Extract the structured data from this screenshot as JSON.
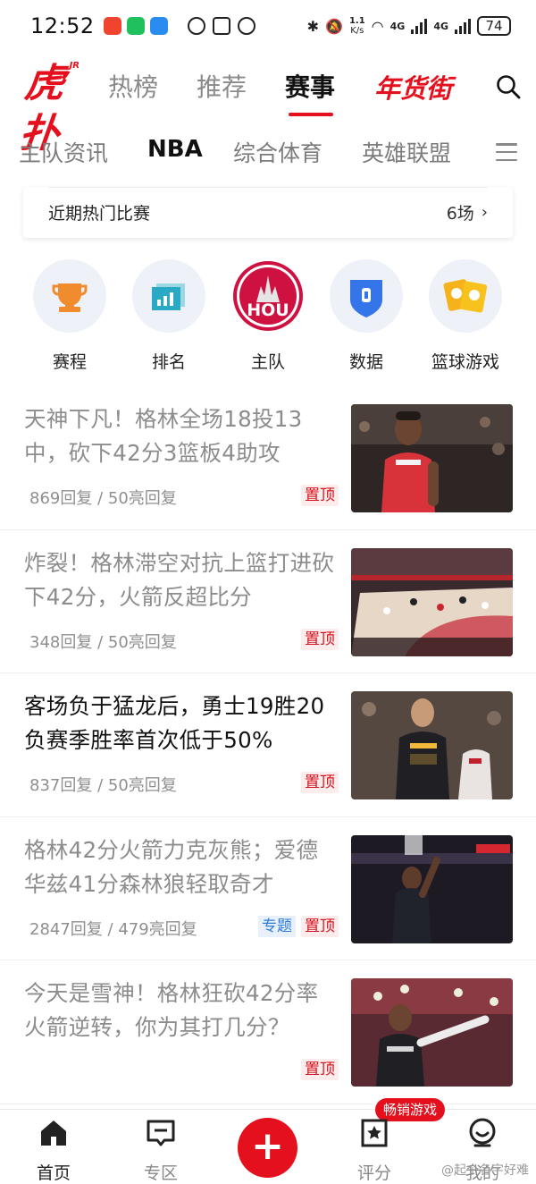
{
  "status_bar": {
    "time": "12:52",
    "speed_value": "1.1",
    "speed_unit": "K/s",
    "network_1": "4G",
    "network_2": "4G",
    "battery": "74"
  },
  "top_nav": {
    "logo_text": "虎扑",
    "logo_badge": "JR",
    "tabs": [
      "热榜",
      "推荐",
      "赛事",
      "年货街"
    ],
    "active_tab": "赛事"
  },
  "sub_nav": {
    "tabs": [
      "主队资讯",
      "NBA",
      "综合体育",
      "英雄联盟"
    ],
    "active_tab": "NBA"
  },
  "hot_games": {
    "title": "近期热门比赛",
    "count": "6场"
  },
  "quick_entries": [
    {
      "label": "赛程",
      "icon": "trophy-icon"
    },
    {
      "label": "排名",
      "icon": "ranking-icon"
    },
    {
      "label": "主队",
      "icon": "hou-team-logo",
      "badge_text": "HOU"
    },
    {
      "label": "数据",
      "icon": "data-shield-icon"
    },
    {
      "label": "篮球游戏",
      "icon": "game-tickets-icon"
    }
  ],
  "feed": [
    {
      "title": "天神下凡！格林全场18投13中，砍下42分3篮板4助攻",
      "meta": "869回复 / 50亮回复",
      "tags": [
        "置顶"
      ],
      "read": true
    },
    {
      "title": "炸裂！格林滞空对抗上篮打进砍下42分，火箭反超比分",
      "meta": "348回复 / 50亮回复",
      "tags": [
        "置顶"
      ],
      "read": true
    },
    {
      "title": "客场负于猛龙后，勇士19胜20负赛季胜率首次低于50%",
      "meta": "837回复 / 50亮回复",
      "tags": [
        "置顶"
      ],
      "read": false
    },
    {
      "title": "格林42分火箭力克灰熊；爱德华兹41分森林狼轻取奇才",
      "meta": "2847回复 / 479亮回复",
      "tags": [
        "专题",
        "置顶"
      ],
      "read": true
    },
    {
      "title": "今天是雪神！格林狂砍42分率火箭逆转，你为其打几分？",
      "meta": "",
      "tags": [
        "置顶"
      ],
      "read": true
    }
  ],
  "bottom_bar": {
    "items": [
      "首页",
      "专区",
      "评分",
      "我的"
    ],
    "active": "首页",
    "post_label": "+",
    "game_badge": "畅销游戏",
    "watermark": "@起个名字好难"
  },
  "colors": {
    "brand_red": "#e5101d",
    "pin_tag_bg": "#fdecec",
    "topic_tag": "#2f7bd9"
  }
}
